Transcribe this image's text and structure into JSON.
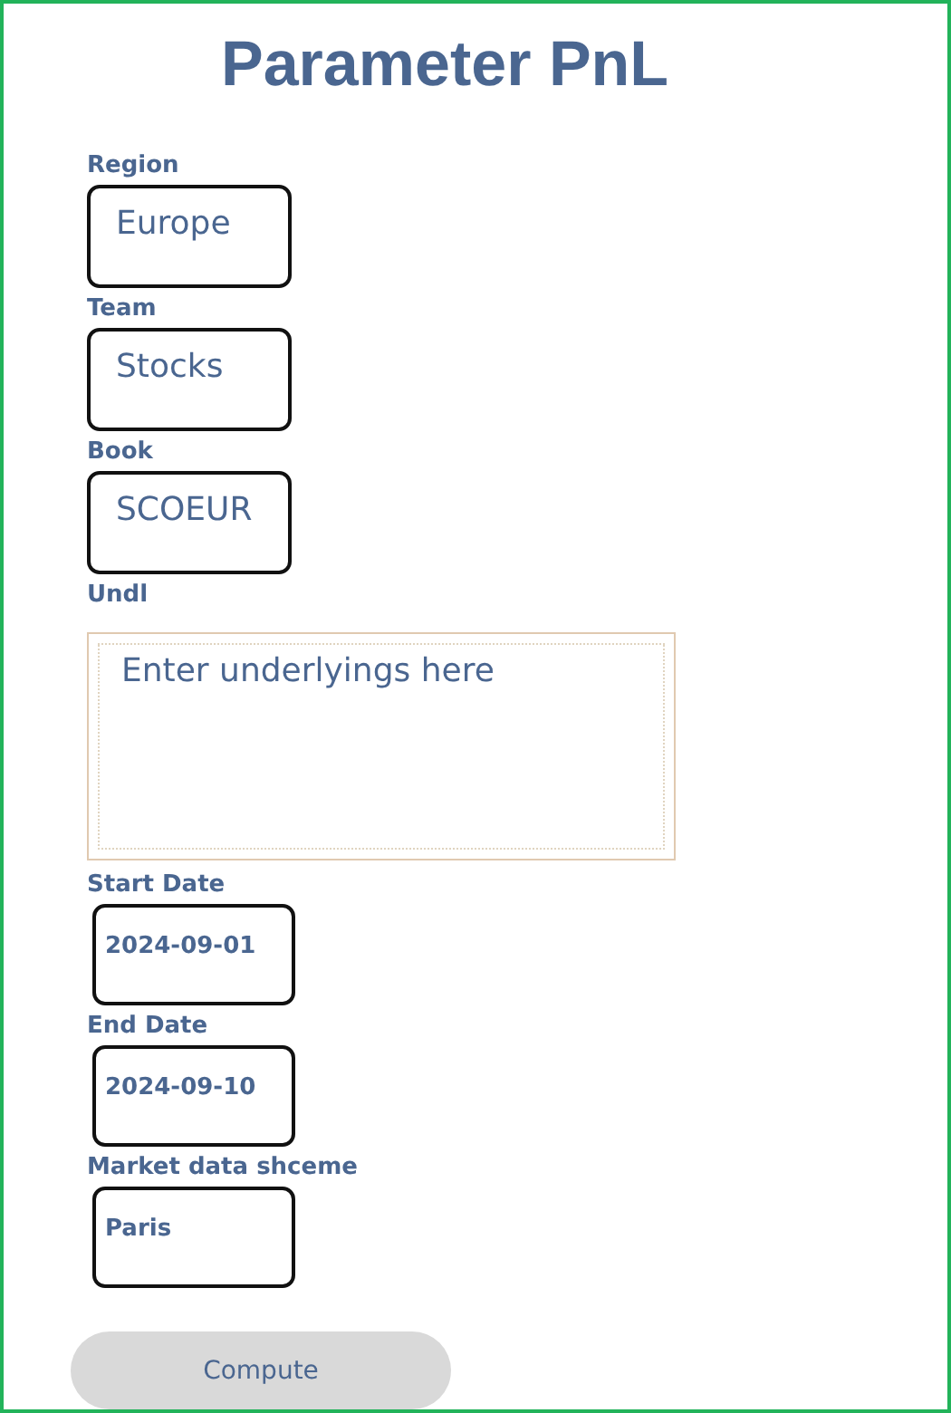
{
  "title": "Parameter PnL",
  "fields": [
    {
      "label": "Region",
      "kind": "large",
      "value": "Europe"
    },
    {
      "label": "Team",
      "kind": "large",
      "value": "Stocks"
    },
    {
      "label": "Book",
      "kind": "large",
      "value": "SCOEUR"
    },
    {
      "label": "Undl",
      "kind": "area",
      "placeholder": "Enter underlyings here"
    },
    {
      "label": "Start Date",
      "kind": "small",
      "value": "2024-09-01"
    },
    {
      "label": "End Date",
      "kind": "small",
      "value": "2024-09-10"
    },
    {
      "label": "Market data shceme",
      "kind": "small",
      "value": "Paris"
    }
  ],
  "button": "Compute"
}
